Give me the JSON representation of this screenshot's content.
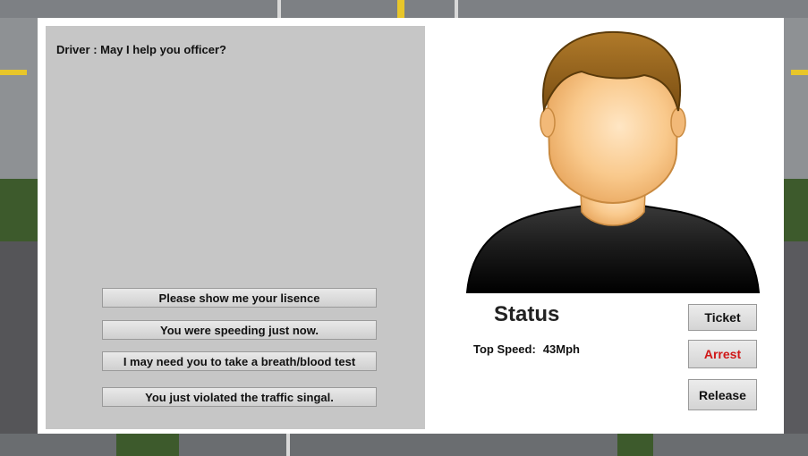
{
  "dialog": {
    "driver_line": "Driver : May I help you officer?",
    "options": [
      "Please show me your lisence",
      "You were speeding just now.",
      "I may need you to take a breath/blood test",
      "You just violated the traffic singal."
    ]
  },
  "avatar": {
    "icon": "driver-portrait-icon"
  },
  "status": {
    "title": "Status",
    "top_speed_label": "Top Speed:",
    "top_speed_value": "43Mph"
  },
  "actions": {
    "ticket": "Ticket",
    "arrest": "Arrest",
    "release": "Release"
  },
  "colors": {
    "arrest_text": "#d01818",
    "dialog_bg": "#c6c6c6",
    "panel_bg": "#ffffff"
  }
}
